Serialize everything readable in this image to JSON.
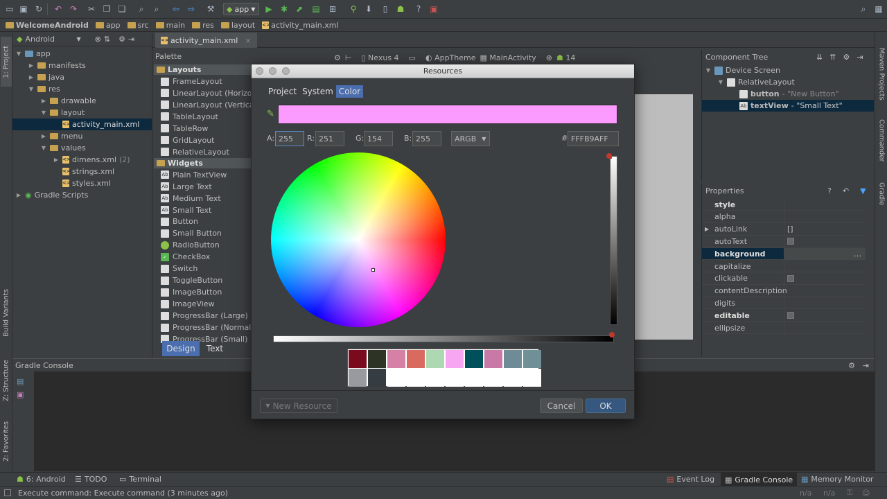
{
  "toolbar": {
    "run_config": "app",
    "icons": [
      "open-icon",
      "save-icon",
      "sync-icon",
      "undo-icon",
      "redo-icon",
      "cut-icon",
      "copy-icon",
      "paste-icon",
      "find-icon",
      "replace-icon",
      "back-icon",
      "forward-icon",
      "make-icon",
      "run-icon",
      "debug-icon",
      "attach-icon",
      "coverage-icon",
      "profile-icon",
      "avd-icon",
      "sdk-icon",
      "android-icon",
      "help-icon",
      "device-monitor-icon",
      "search-icon"
    ]
  },
  "breadcrumbs": [
    "WelcomeAndroid",
    "app",
    "src",
    "main",
    "res",
    "layout",
    "activity_main.xml"
  ],
  "project_panel": {
    "view_mode": "Android",
    "tree": [
      {
        "label": "app",
        "depth": 0,
        "open": true
      },
      {
        "label": "manifests",
        "depth": 1,
        "open": false
      },
      {
        "label": "java",
        "depth": 1,
        "open": false
      },
      {
        "label": "res",
        "depth": 1,
        "open": true
      },
      {
        "label": "drawable",
        "depth": 2,
        "open": false
      },
      {
        "label": "layout",
        "depth": 2,
        "open": true
      },
      {
        "label": "activity_main.xml",
        "depth": 3,
        "selected": true
      },
      {
        "label": "menu",
        "depth": 2,
        "open": false
      },
      {
        "label": "values",
        "depth": 2,
        "open": true
      },
      {
        "label": "dimens.xml",
        "suffix": "(2)",
        "depth": 3,
        "open": false
      },
      {
        "label": "strings.xml",
        "depth": 3
      },
      {
        "label": "styles.xml",
        "depth": 3
      },
      {
        "label": "Gradle Scripts",
        "depth": 0,
        "open": false
      }
    ]
  },
  "left_stripe": {
    "project": "1: Project",
    "build_variants": "Build Variants",
    "structure": "Z: Structure",
    "favorites": "2: Favorites"
  },
  "right_stripe": {
    "maven": "Maven Projects",
    "commander": "Commander",
    "gradle": "Gradle"
  },
  "editor": {
    "tab": "activity_main.xml"
  },
  "palette": {
    "title": "Palette",
    "groups": [
      {
        "name": "Layouts",
        "items": [
          "FrameLayout",
          "LinearLayout (Horizon",
          "LinearLayout (Vertical)",
          "TableLayout",
          "TableRow",
          "GridLayout",
          "RelativeLayout"
        ]
      },
      {
        "name": "Widgets",
        "items": [
          "Plain TextView",
          "Large Text",
          "Medium Text",
          "Small Text",
          "Button",
          "Small Button",
          "RadioButton",
          "CheckBox",
          "Switch",
          "ToggleButton",
          "ImageButton",
          "ImageView",
          "ProgressBar (Large)",
          "ProgressBar (Normal)",
          "ProgressBar (Small)"
        ]
      }
    ],
    "design_tab": "Design",
    "text_tab": "Text"
  },
  "design_toolbar": {
    "device": "Nexus 4",
    "theme": "AppTheme",
    "activity": "MainActivity",
    "api": "14"
  },
  "component_tree": {
    "title": "Component Tree",
    "items": [
      {
        "label": "Device Screen",
        "depth": 0
      },
      {
        "label": "RelativeLayout",
        "depth": 1
      },
      {
        "label": "button",
        "hint": "- \"New Button\"",
        "depth": 2
      },
      {
        "label": "textView",
        "hint": "- \"Small Text\"",
        "depth": 2,
        "selected": true
      }
    ]
  },
  "properties": {
    "title": "Properties",
    "rows": [
      {
        "name": "style",
        "value": "",
        "bold": true
      },
      {
        "name": "alpha",
        "value": ""
      },
      {
        "name": "autoLink",
        "value": "[]",
        "expandable": true
      },
      {
        "name": "autoText",
        "value": "",
        "checkbox": true
      },
      {
        "name": "background",
        "value": "",
        "bold": true,
        "highlight": true
      },
      {
        "name": "capitalize",
        "value": ""
      },
      {
        "name": "clickable",
        "value": "",
        "checkbox": true
      },
      {
        "name": "contentDescription",
        "value": ""
      },
      {
        "name": "digits",
        "value": ""
      },
      {
        "name": "editable",
        "value": "",
        "checkbox": true,
        "bold": true
      },
      {
        "name": "ellipsize",
        "value": ""
      }
    ]
  },
  "gradle_console": {
    "title": "Gradle Console"
  },
  "bottom_tools": {
    "left": [
      {
        "label": "6: Android"
      },
      {
        "label": "TODO"
      },
      {
        "label": "Terminal"
      }
    ],
    "right": [
      {
        "label": "Event Log"
      },
      {
        "label": "Gradle Console"
      },
      {
        "label": "Memory Monitor"
      }
    ]
  },
  "status_bar": {
    "message": "Execute command: Execute command (3 minutes ago)",
    "na1": "n/a",
    "na2": "n/a"
  },
  "dialog": {
    "title": "Resources",
    "tabs": [
      "Project",
      "System",
      "Color"
    ],
    "active_tab": "Color",
    "color_hex": "#fb9aff",
    "a_label": "A:",
    "a_value": "255",
    "r_label": "R:",
    "r_value": "251",
    "g_label": "G:",
    "g_value": "154",
    "b_label": "B:",
    "b_value": "255",
    "mode": "ARGB",
    "hash_label": "#",
    "hex_value": "FFFB9AFF",
    "recent_colors": [
      "#7a0a1e",
      "#2e3425",
      "#d481a5",
      "#d86a5f",
      "#aed8b1",
      "#f7a6f2",
      "#00505c",
      "#c979a5",
      "#6f8b95",
      "#6e9096",
      "#999a9f",
      "#353c42",
      "#ffffff",
      "#ffffff",
      "#ffffff",
      "#ffffff",
      "#ffffff",
      "#ffffff",
      "#ffffff",
      "#ffffff"
    ],
    "new_resource": "New Resource",
    "cancel": "Cancel",
    "ok": "OK"
  }
}
